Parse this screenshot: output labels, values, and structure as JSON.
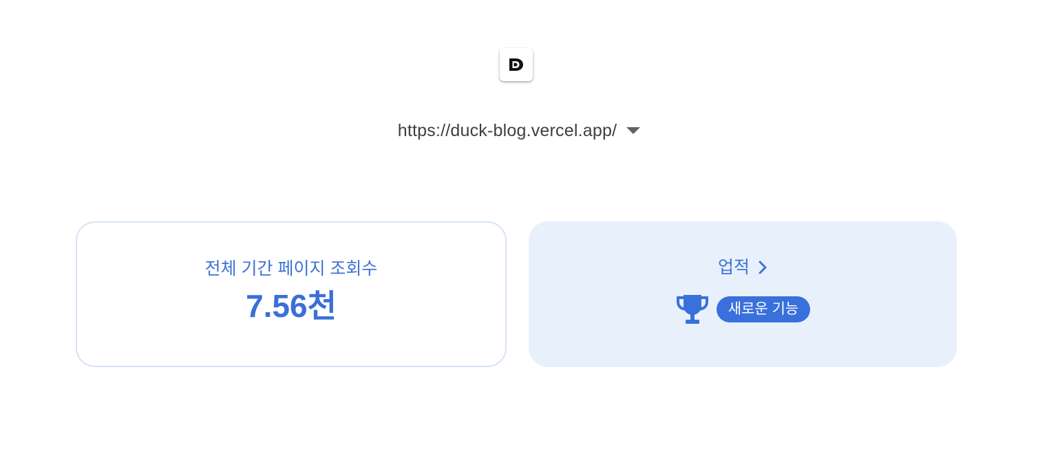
{
  "header": {
    "logo_icon": "duck-blog-logo-icon",
    "property_url": "https://duck-blog.vercel.app/",
    "dropdown_icon": "caret-down-icon"
  },
  "cards": {
    "views": {
      "title": "전체 기간 페이지 조회수",
      "value": "7.56천"
    },
    "achievements": {
      "title": "업적",
      "chevron_icon": "chevron-right-icon",
      "trophy_icon": "trophy-icon",
      "badge": "새로운 기능"
    }
  },
  "colors": {
    "accent_blue": "#3a6fd8",
    "card_border": "#d6e2f5",
    "achievement_bg": "#e8f0fc",
    "url_text": "#3c4043",
    "caret": "#5f6368"
  }
}
